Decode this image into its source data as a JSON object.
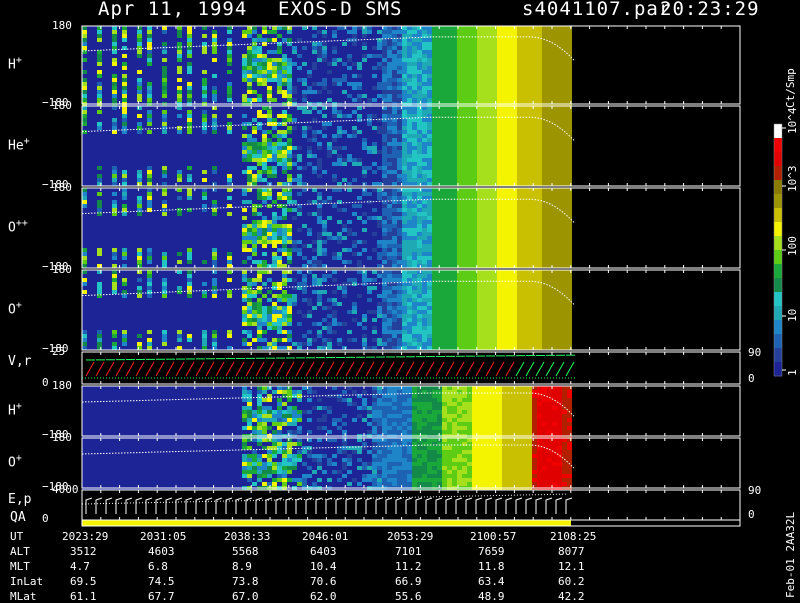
{
  "header": {
    "date": "Apr 11, 1994",
    "instrument": "EXOS-D SMS",
    "file": "s4041107.par",
    "time": "20:23:29"
  },
  "colorbar": {
    "unit": "Ct/Smp",
    "ticks": [
      "1",
      "10",
      "100",
      "10^3",
      "10^4"
    ],
    "colors": [
      "#1c2496",
      "#24409a",
      "#1e62b4",
      "#1e86c8",
      "#1fa9b5",
      "#22c4c4",
      "#138a4a",
      "#1aa83a",
      "#5ccc14",
      "#a6e01c",
      "#f4f400",
      "#c8c000",
      "#9c9400",
      "#8a7a00",
      "#b22000",
      "#e00000",
      "#f00000",
      "#ffffff"
    ]
  },
  "chart_data": {
    "type": "heatmap",
    "panels": [
      {
        "label": "H",
        "superscript": "+",
        "ymax": "180",
        "ymin": "−180"
      },
      {
        "label": "He",
        "superscript": "+",
        "ymax": "180",
        "ymin": "−180"
      },
      {
        "label": "O",
        "superscript": "++",
        "ymax": "180",
        "ymin": "−180"
      },
      {
        "label": "O",
        "superscript": "+",
        "ymax": "180",
        "ymin": "−180"
      },
      {
        "label": "V,r",
        "superscript": "",
        "ymax": "25",
        "ymin": "0",
        "right_top": "90",
        "right_bottom": "0"
      },
      {
        "label": "H",
        "superscript": "+",
        "ymax": "180",
        "ymin": "−180"
      },
      {
        "label": "O",
        "superscript": "+",
        "ymax": "180",
        "ymin": "−180"
      },
      {
        "label": "E,p",
        "superscript": "",
        "ymax": "4000",
        "ymin": "0",
        "right_top": "90",
        "right_bottom": "0"
      }
    ],
    "qa_label": "QA",
    "ephemeris": {
      "row_labels": [
        "UT",
        "ALT",
        "MLT",
        "InLat",
        "MLat"
      ],
      "columns": [
        [
          "2023:29",
          "3512",
          "4.7",
          "69.5",
          "61.1"
        ],
        [
          "2031:05",
          "4603",
          "6.8",
          "74.5",
          "67.7"
        ],
        [
          "2038:33",
          "5568",
          "8.9",
          "73.8",
          "67.0"
        ],
        [
          "2046:01",
          "6403",
          "10.4",
          "70.6",
          "62.0"
        ],
        [
          "2053:29",
          "7101",
          "11.2",
          "66.9",
          "55.6"
        ],
        [
          "2100:57",
          "7659",
          "11.8",
          "63.4",
          "48.9"
        ],
        [
          "2108:25",
          "8077",
          "12.1",
          "60.2",
          "42.2"
        ]
      ]
    },
    "footer": "Feb-01 2AA32L"
  }
}
